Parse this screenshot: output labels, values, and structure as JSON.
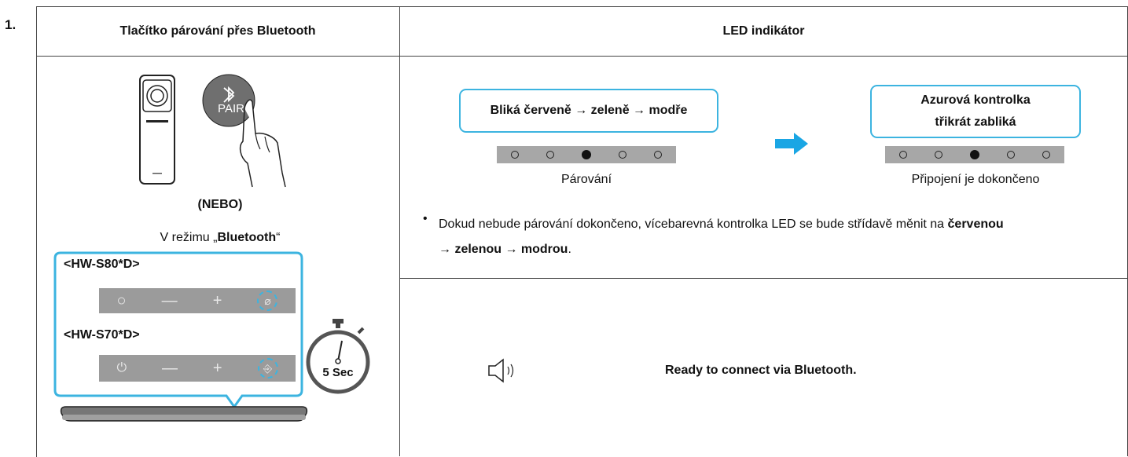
{
  "step_number": "1.",
  "headers": {
    "left": "Tlačítko párování přes Bluetooth",
    "right": "LED indikátor"
  },
  "left": {
    "pair_label": "PAIR",
    "or_label": "(NEBO)",
    "mode_prefix": "V režimu „",
    "mode_name": "Bluetooth",
    "mode_suffix": "“",
    "model_a": "<HW-S80*D>",
    "model_b": "<HW-S70*D>",
    "timer_label": "5 Sec"
  },
  "led": {
    "pairing_bubble": "Bliká červeně → zeleně → modře",
    "pairing_caption": "Párování",
    "connected_bubble_line1": "Azurová kontrolka",
    "connected_bubble_line2": "třikrát zabliká",
    "connected_caption": "Připojení je dokončeno",
    "note_prefix": "Dokud nebude párování dokončeno, vícebarevná kontrolka LED se bude střídavě měnit na ",
    "note_red": "červenou",
    "note_arrow1": "→ ",
    "note_green": "zelenou",
    "note_arrow2": " → ",
    "note_blue": "modrou",
    "note_end": ".",
    "leds": [
      false,
      false,
      true,
      false,
      false
    ]
  },
  "voice": {
    "message": "Ready to connect via Bluetooth.",
    "icon": "speaker-icon"
  },
  "colors": {
    "accent": "#3cb4e0",
    "led_bar": "#a7a7a7",
    "panel": "#9b9b9b"
  }
}
